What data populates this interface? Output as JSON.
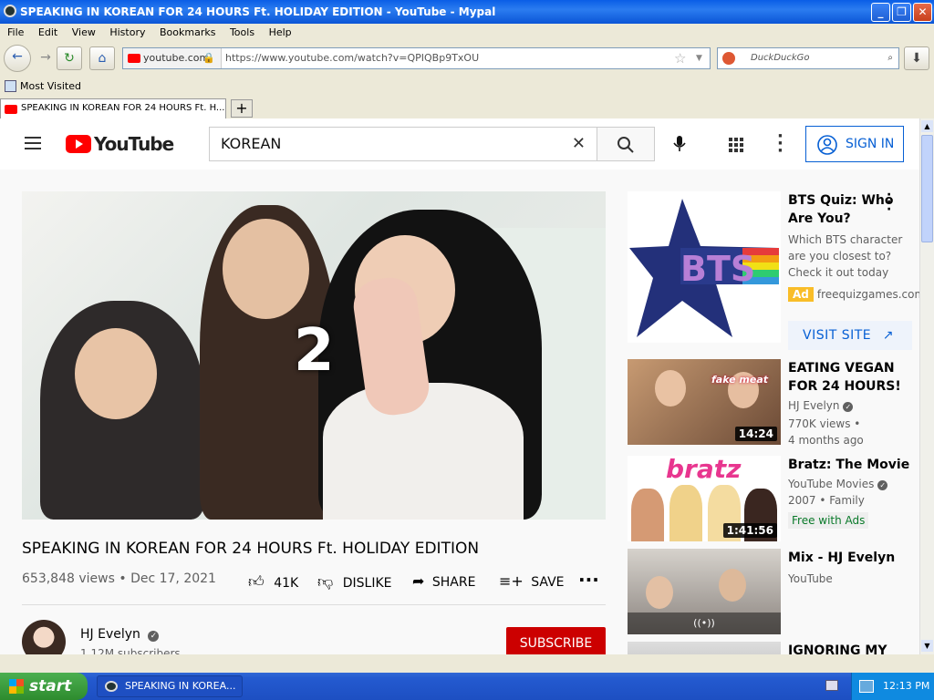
{
  "window": {
    "title": "SPEAKING IN KOREAN FOR 24 HOURS Ft. HOLIDAY EDITION - YouTube - Mypal"
  },
  "menu": [
    "File",
    "Edit",
    "View",
    "History",
    "Bookmarks",
    "Tools",
    "Help"
  ],
  "nav": {
    "site_badge": "youtube.com",
    "url": "https://www.youtube.com/watch?v=QPIQBp9TxOU",
    "search_placeholder": "DuckDuckGo"
  },
  "bookmarks": {
    "most_visited": "Most Visited"
  },
  "tab": {
    "label": "SPEAKING IN KOREAN FOR 24 HOURS Ft. H..."
  },
  "yt": {
    "logo": "YouTube",
    "search_value": "KOREAN",
    "sign_in": "SIGN IN",
    "video_overlay_number": "2",
    "video_title": "SPEAKING IN KOREAN FOR 24 HOURS Ft. HOLIDAY EDITION",
    "views": "653,848 views",
    "date": "Dec 17, 2021",
    "likes": "41K",
    "dislike": "DISLIKE",
    "share": "SHARE",
    "save": "SAVE",
    "channel": "HJ Evelyn",
    "subscribers": "1.12M subscribers",
    "subscribe": "SUBSCRIBE"
  },
  "ad": {
    "title": "BTS Quiz: Who Are You?",
    "desc": "Which BTS character are you closest to? Check it out today",
    "badge": "Ad",
    "domain": "freequizgames.com",
    "cta": "VISIT SITE",
    "logo_text": "BTS"
  },
  "related": [
    {
      "title": "EATING VEGAN FOR 24 HOURS!",
      "channel": "HJ Evelyn",
      "meta1": "770K views •",
      "meta2": "4 months ago",
      "duration": "14:24",
      "thumb_text": "fake meat"
    },
    {
      "title": "Bratz: The Movie",
      "channel": "YouTube Movies",
      "meta1": "2007 • Family",
      "meta2": "Free with Ads",
      "duration": "1:41:56",
      "thumb_text": "bratz"
    },
    {
      "title": "Mix - HJ Evelyn",
      "channel": "YouTube",
      "meta1": "",
      "meta2": "",
      "duration": "",
      "thumb_text": "((•))"
    },
    {
      "title": "IGNORING MY",
      "channel": "",
      "meta1": "",
      "meta2": "",
      "duration": "",
      "thumb_text": ""
    }
  ],
  "taskbar": {
    "start": "start",
    "item": "SPEAKING IN KOREA...",
    "clock": "12:13 PM"
  },
  "colors": {
    "yt_red": "#ff0000",
    "subscribe_red": "#cc0000",
    "link_blue": "#065fd4",
    "xp_blue": "#245ad0"
  }
}
